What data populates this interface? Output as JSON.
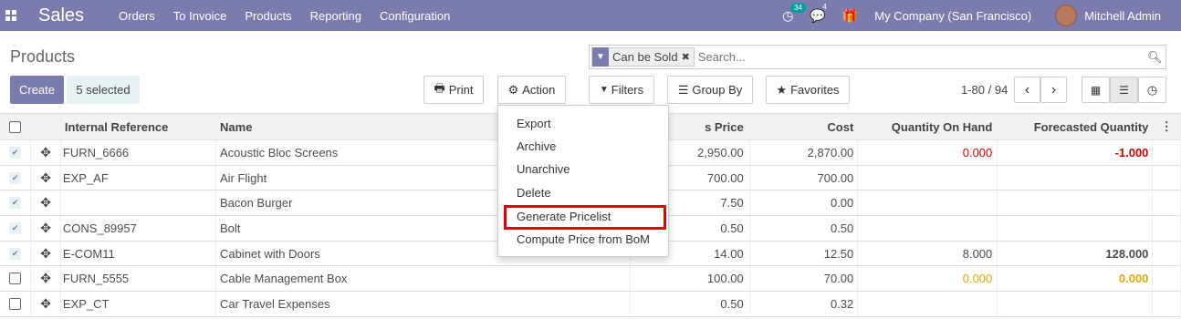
{
  "navbar": {
    "brand": "Sales",
    "menus": [
      "Orders",
      "To Invoice",
      "Products",
      "Reporting",
      "Configuration"
    ],
    "activity_count": "34",
    "messages_count": "4",
    "company": "My Company (San Francisco)",
    "user": "Mitchell Admin"
  },
  "page": {
    "title": "Products",
    "search_facet": "Can be Sold",
    "search_placeholder": "Search...",
    "create_label": "Create",
    "selected_label": "5 selected",
    "print_label": "Print",
    "action_label": "Action",
    "filters_label": "Filters",
    "groupby_label": "Group By",
    "favorites_label": "Favorites",
    "pager": "1-80 / 94"
  },
  "table": {
    "headers": {
      "internal_reference": "Internal Reference",
      "name": "Name",
      "sales_price": "s Price",
      "cost": "Cost",
      "qty_on_hand": "Quantity On Hand",
      "forecasted_qty": "Forecasted Quantity"
    },
    "rows": [
      {
        "checked": true,
        "ref": "FURN_6666",
        "name": "Acoustic Bloc Screens",
        "price": "2,950.00",
        "cost": "2,870.00",
        "qty": "0.000",
        "qty_style": "red",
        "fq": "-1.000",
        "fq_style": "neg-bold"
      },
      {
        "checked": true,
        "ref": "EXP_AF",
        "name": "Air Flight",
        "price": "700.00",
        "cost": "700.00",
        "qty": "",
        "qty_style": "",
        "fq": "",
        "fq_style": ""
      },
      {
        "checked": true,
        "ref": "",
        "name": "Bacon Burger",
        "price": "7.50",
        "cost": "0.00",
        "qty": "",
        "qty_style": "",
        "fq": "",
        "fq_style": ""
      },
      {
        "checked": true,
        "ref": "CONS_89957",
        "name": "Bolt",
        "price": "0.50",
        "cost": "0.50",
        "qty": "",
        "qty_style": "",
        "fq": "",
        "fq_style": ""
      },
      {
        "checked": true,
        "ref": "E-COM11",
        "name": "Cabinet with Doors",
        "price": "14.00",
        "cost": "12.50",
        "qty": "8.000",
        "qty_style": "",
        "fq": "128.000",
        "fq_style": "bold"
      },
      {
        "checked": false,
        "ref": "FURN_5555",
        "name": "Cable Management Box",
        "price": "100.00",
        "cost": "70.00",
        "qty": "0.000",
        "qty_style": "orange",
        "fq": "0.000",
        "fq_style": "orange bold"
      },
      {
        "checked": false,
        "ref": "EXP_CT",
        "name": "Car Travel Expenses",
        "price": "0.50",
        "cost": "0.32",
        "qty": "",
        "qty_style": "",
        "fq": "",
        "fq_style": ""
      }
    ]
  },
  "action_menu": {
    "items": [
      "Export",
      "Archive",
      "Unarchive",
      "Delete",
      "Generate Pricelist",
      "Compute Price from BoM"
    ]
  },
  "colors": {
    "navbar": "#7c7bad",
    "highlight": "#e60000"
  }
}
